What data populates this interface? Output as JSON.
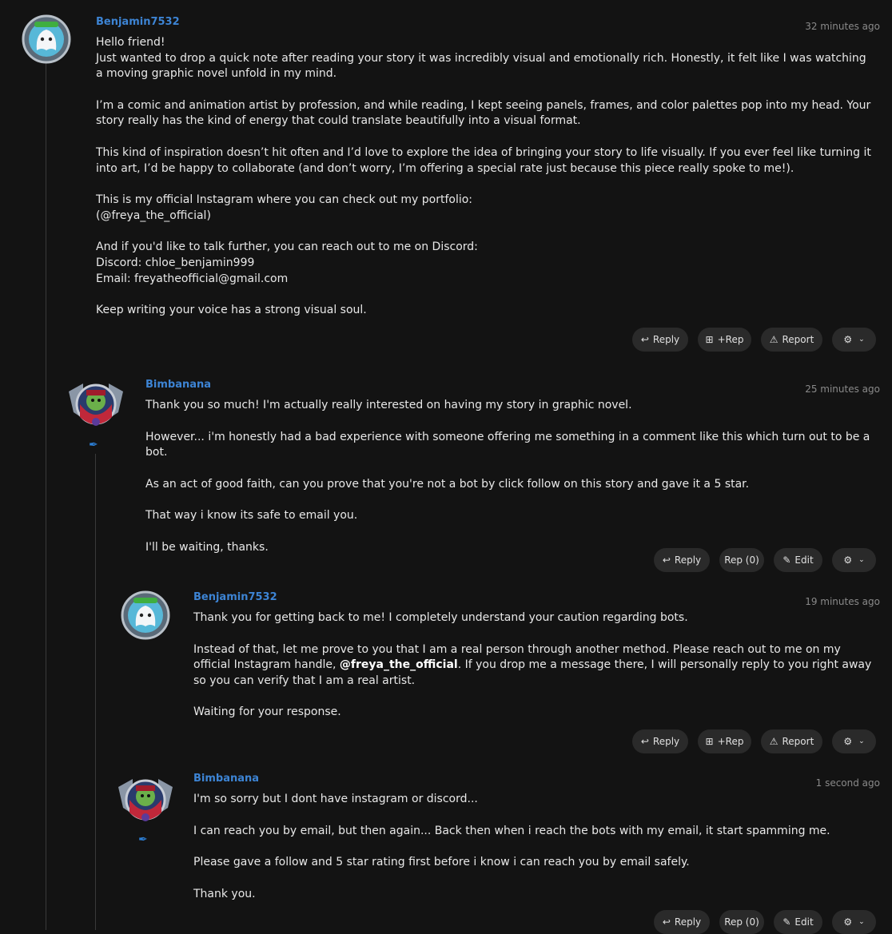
{
  "comments": [
    {
      "author": "Benjamin7532",
      "time": "32 minutes ago",
      "paragraphs": [
        "Hello friend!\nJust wanted to drop a quick note after reading your story it was incredibly visual and emotionally rich. Honestly, it felt like I was watching a moving graphic novel unfold in my mind.",
        "I’m a comic and animation artist by profession, and while reading, I kept seeing panels, frames, and color palettes pop into my head. Your story really has the kind of energy that could translate beautifully into a visual format.",
        "This kind of inspiration doesn’t hit often and I’d love to explore the idea of bringing your story to life visually. If you ever feel like turning it into art, I’d be happy to collaborate (and don’t worry, I’m offering a special rate just because this piece really spoke to me!).",
        "This is my official Instagram where you can check out my portfolio:\n(@freya_the_official)",
        "And if you'd like to talk further, you can reach out to me on Discord:\nDiscord: chloe_benjamin999\nEmail: freyatheofficial@gmail.com",
        "Keep writing your voice has a strong visual soul."
      ],
      "actions": {
        "reply": "Reply",
        "rep": "+Rep",
        "report": "Report"
      }
    },
    {
      "author": "Bimbanana",
      "time": "25 minutes ago",
      "paragraphs": [
        "Thank you so much! I'm actually really interested on having my story in graphic novel.",
        "However... i'm honestly had a bad experience with someone offering me something in a comment like this which turn out to be a bot.",
        "As an act of good faith, can you prove that you're not a bot by click follow on this story and gave it a 5 star.",
        "That way i know its safe to email you.",
        "I'll be waiting, thanks."
      ],
      "actions": {
        "reply": "Reply",
        "rep": "Rep (0)",
        "edit": "Edit"
      }
    },
    {
      "author": "Benjamin7532",
      "time": "19 minutes ago",
      "p1": "Thank you for getting back to me! I completely understand your caution regarding bots.",
      "p2_pre": "Instead of that, let me prove to you that I am a real person through another method. Please reach out to me on my official Instagram handle, ",
      "p2_bold": "@freya_the_official",
      "p2_post": ". If you drop me a message there, I will personally reply to you right away so you can verify that I am a real artist.",
      "p3": "Waiting for your response.",
      "actions": {
        "reply": "Reply",
        "rep": "+Rep",
        "report": "Report"
      }
    },
    {
      "author": "Bimbanana",
      "time": "1 second ago",
      "paragraphs": [
        "I'm so sorry but I dont have instagram or discord...",
        "I can reach you by email, but then again... Back then when i reach the bots with my email, it start spamming me.",
        "Please gave a follow and 5 star rating first before i know i can reach you by email safely.",
        "Thank you."
      ],
      "actions": {
        "reply": "Reply",
        "rep": "Rep (0)",
        "edit": "Edit"
      }
    }
  ],
  "icons": {
    "reply": "reply-icon",
    "rep": "plus-square-icon",
    "report": "warning-icon",
    "edit": "edit-icon",
    "settings": "gear-icon",
    "dropdown": "chevron-down-icon",
    "badge": "feather-icon"
  },
  "colors": {
    "background": "#131313",
    "author": "#3d84d4",
    "button": "#2a2a2a",
    "muted": "#8a8a8a",
    "feather": "#2c7fd6"
  }
}
